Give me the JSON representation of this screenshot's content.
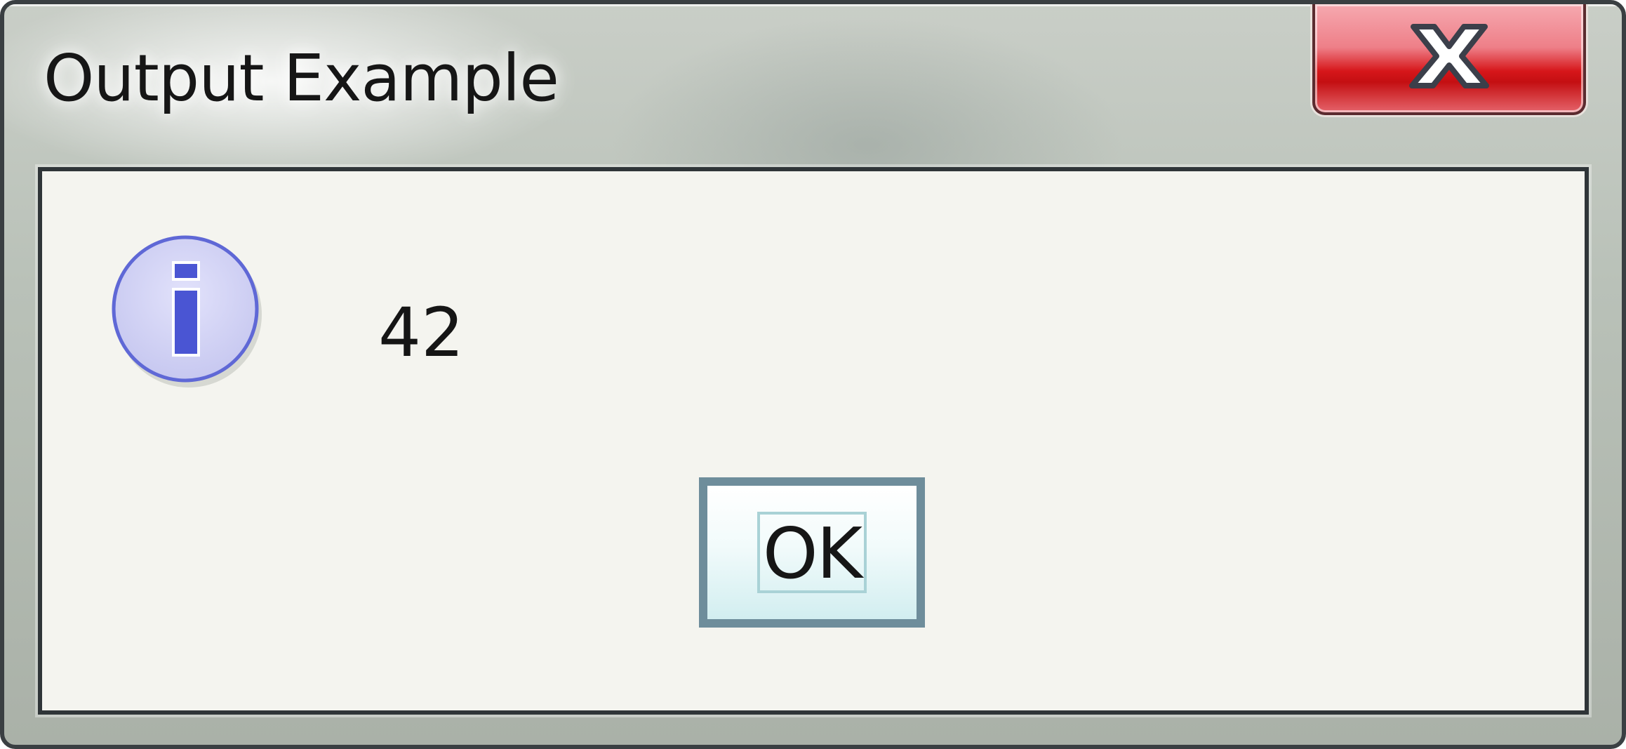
{
  "window": {
    "title": "Output Example"
  },
  "title_bar": {
    "close_icon": "close-icon"
  },
  "dialog": {
    "icon": "info-icon",
    "message": "42",
    "ok_label": "OK"
  },
  "colors": {
    "close_button_red": "#d6161a",
    "info_icon_fill": "#d3d3f4",
    "info_icon_glyph": "#4a55d3",
    "ok_button_border": "#6e8d9b"
  }
}
